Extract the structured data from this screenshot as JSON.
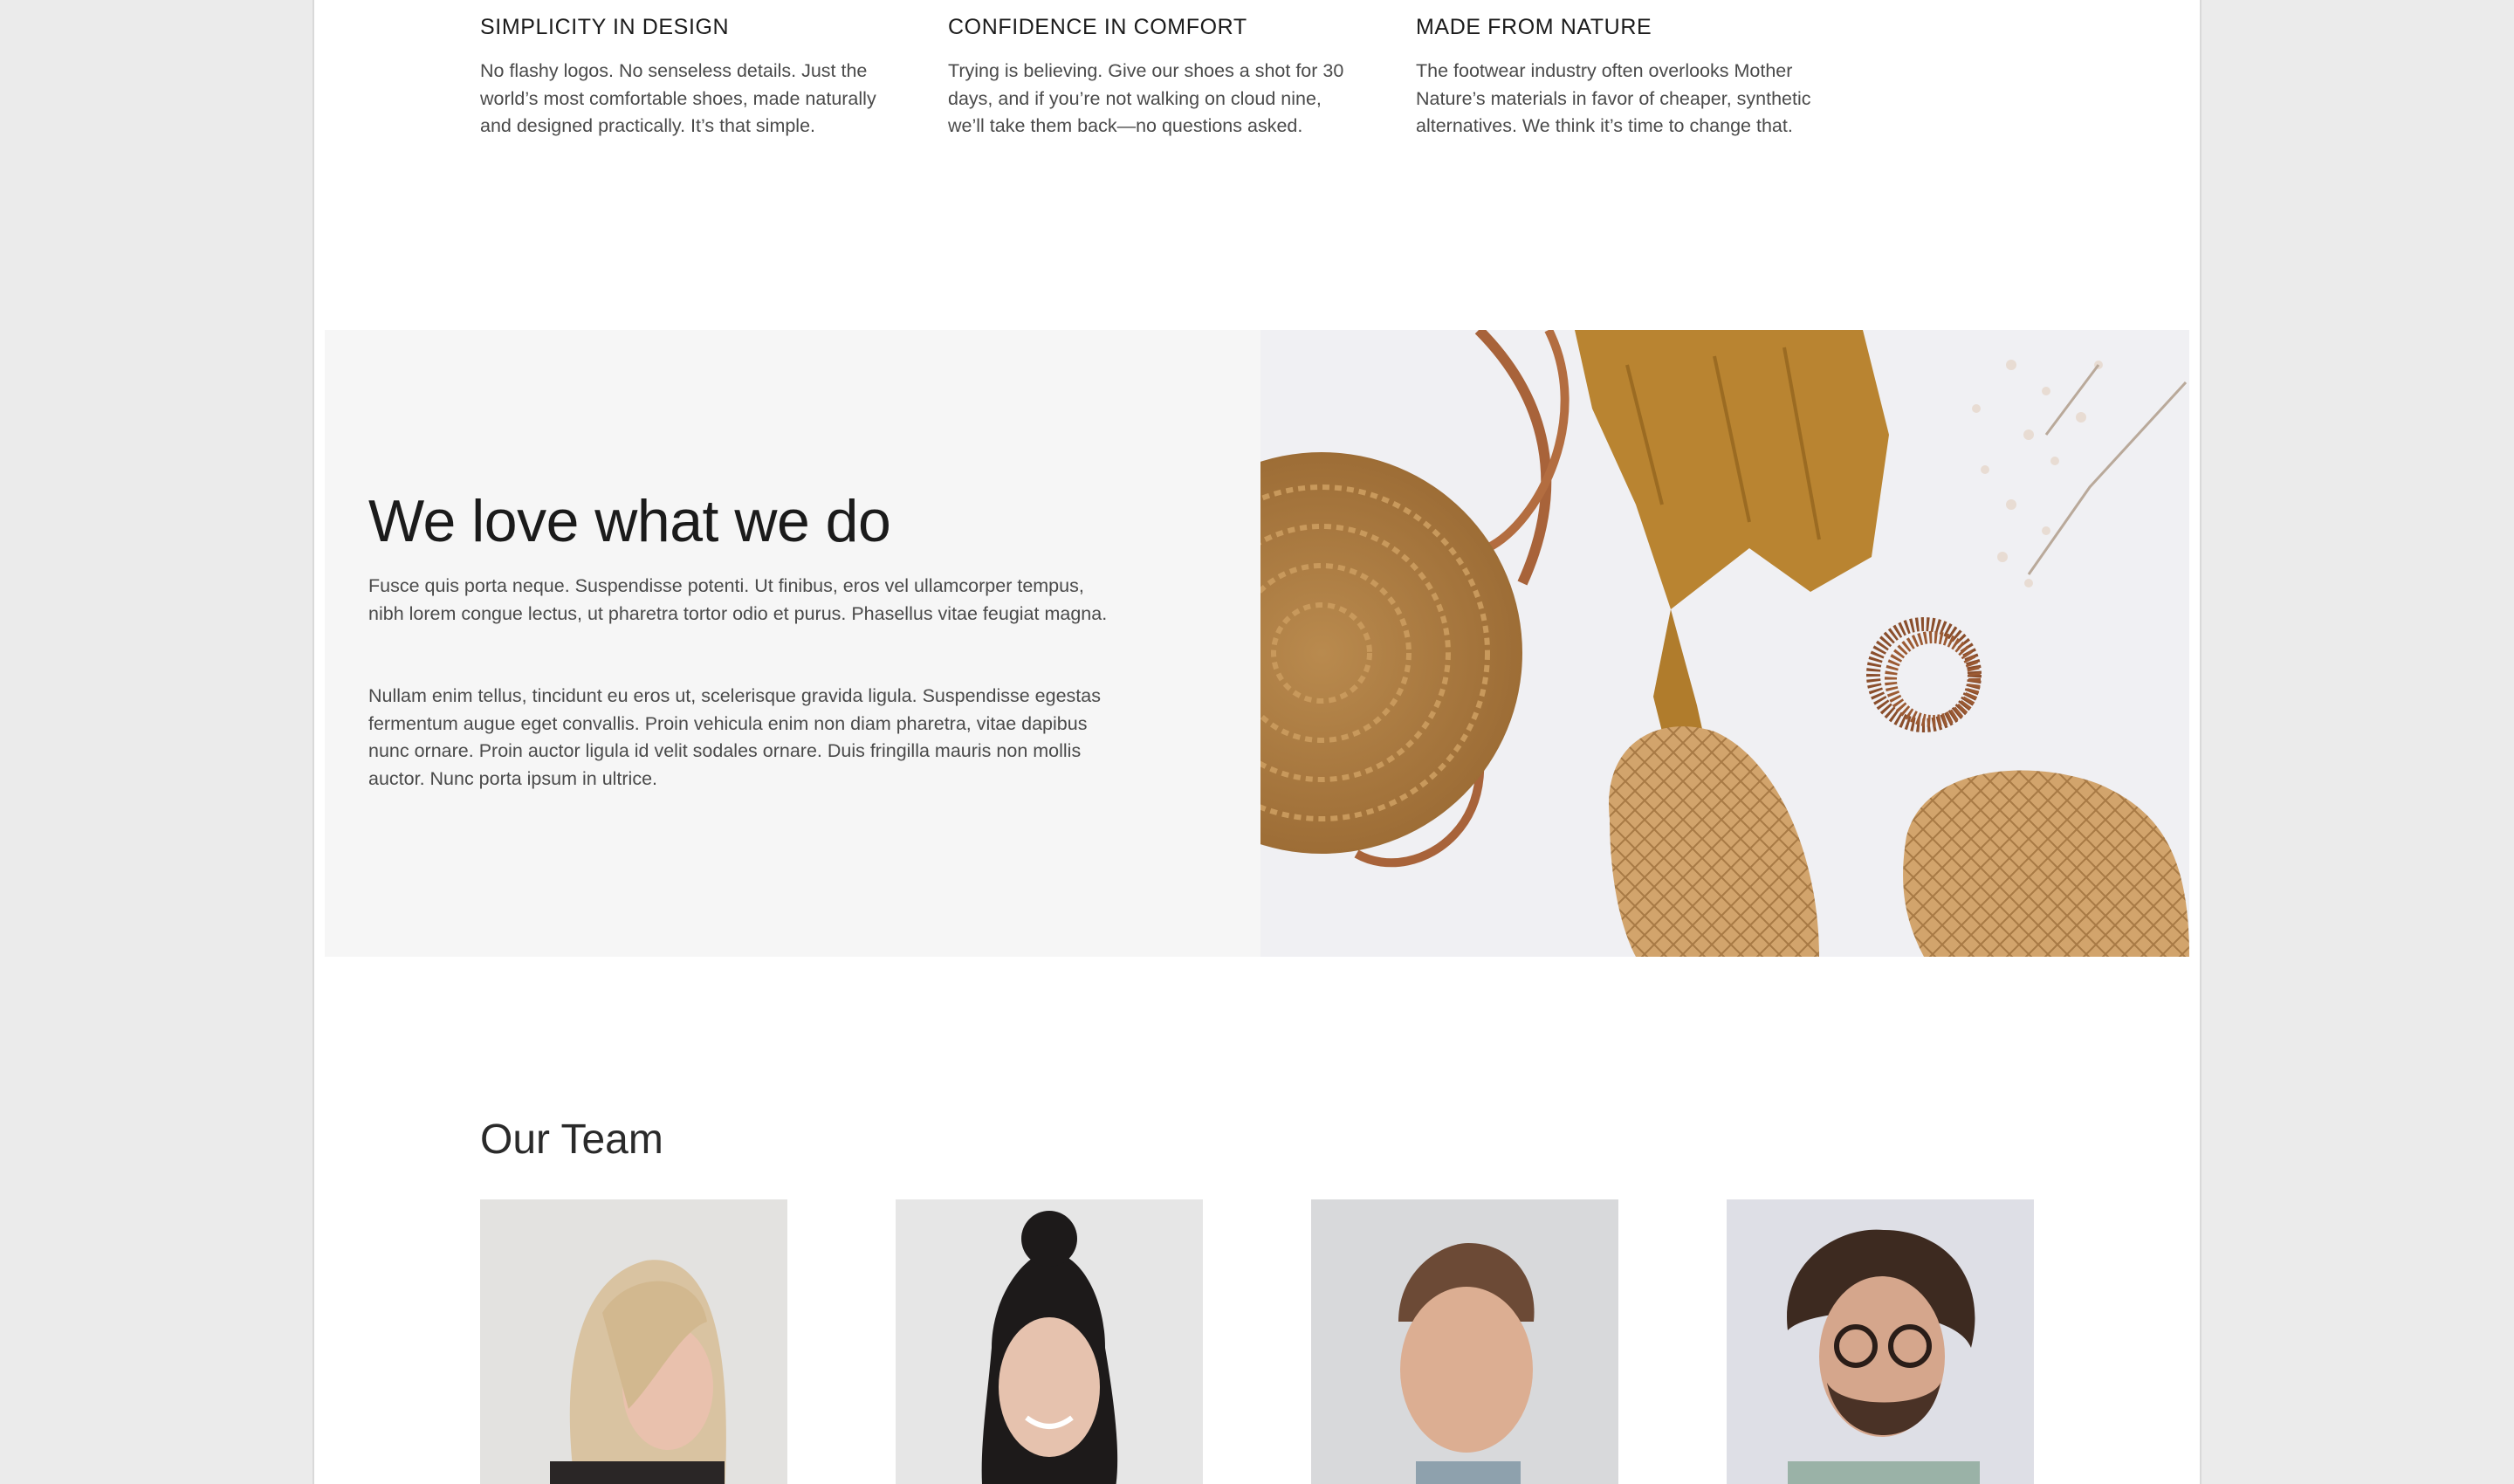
{
  "features": [
    {
      "title": "SIMPLICITY IN DESIGN",
      "body": "No flashy logos. No senseless details. Just the world’s most comfortable shoes, made naturally and designed practically. It’s that simple."
    },
    {
      "title": "CONFIDENCE IN COMFORT",
      "body": "Trying is believing. Give our shoes a shot for 30 days, and if you’re not walking on cloud nine, we’ll take them back—no questions asked."
    },
    {
      "title": "MADE FROM NATURE",
      "body": "The footwear industry often overlooks Mother Nature’s materials in favor of cheaper, synthetic alternatives. We think it’s time to change that."
    }
  ],
  "love": {
    "heading": "We love what we do",
    "paragraph_1": "Fusce quis porta neque. Suspendisse potenti. Ut finibus, eros vel ullamcorper tempus, nibh lorem congue lectus, ut pharetra tortor odio et purus. Phasellus vitae feugiat magna.",
    "paragraph_2": "Nullam enim tellus, tincidunt eu eros ut, scelerisque gravida ligula. Suspendisse egestas fermentum augue eget convallis. Proin vehicula enim non diam pharetra, vitae dapibus nunc ornare. Proin auctor ligula id velit sodales ornare. Duis fringilla mauris non mollis auctor. Nunc porta ipsum in ultrice."
  },
  "team": {
    "title": "Our Team",
    "members": [
      {
        "image": "portrait-blonde-woman"
      },
      {
        "image": "portrait-dark-haired-woman"
      },
      {
        "image": "portrait-short-haired-man"
      },
      {
        "image": "portrait-curly-haired-man-glasses"
      }
    ]
  },
  "colors": {
    "page_bg": "#ffffff",
    "outer_bg": "#ebebeb",
    "love_panel_bg": "#f6f6f6",
    "heading": "#1b1b1b",
    "body_text": "#4a4a4a"
  }
}
